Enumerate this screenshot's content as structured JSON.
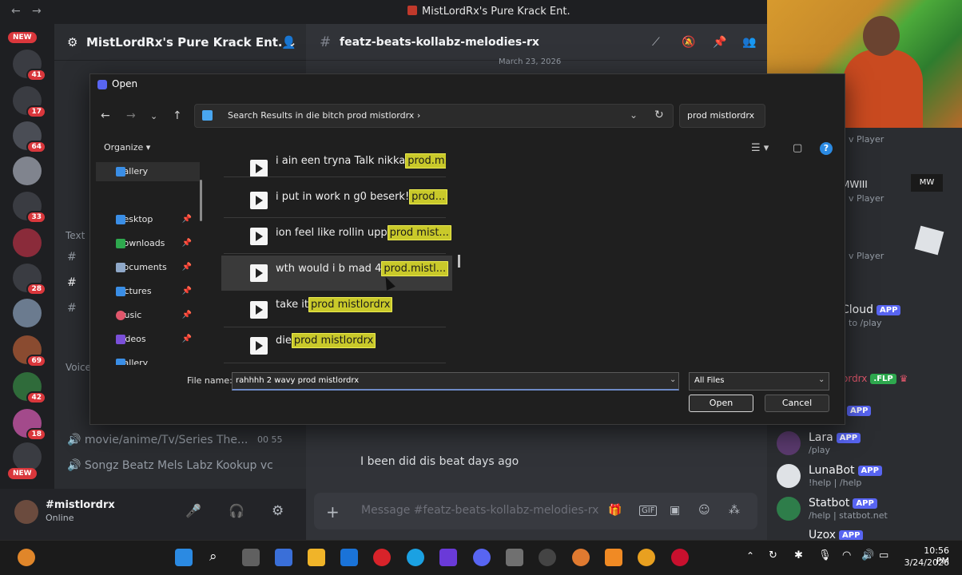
{
  "window": {
    "title": "MistLordRx's Pure Krack Ent."
  },
  "server_rail": {
    "new_label": "NEW",
    "badges": [
      "41",
      "17",
      "64",
      "33",
      "28",
      "69",
      "42",
      "18"
    ],
    "bottom_new_label": "NEW"
  },
  "guild": {
    "name": "MistLordRx's Pure Krack Ent."
  },
  "sidebar": {
    "text_label": "Text",
    "voice_label": "Voice",
    "voice_channel_1": "movie/anime/Tv/Series The...",
    "voice_channel_1_counts": "00  55",
    "voice_channel_2": "Songz Beatz Mels Labz Kookup vc"
  },
  "user_panel": {
    "name": "#mistlordrx",
    "status": "Online"
  },
  "chat": {
    "channel": "featz-beats-kollabz-melodies-rx",
    "date_divider": "March 23, 2026",
    "message": "I been did dis beat days ago",
    "composer_placeholder": "Message #featz-beats-kollabz-melodies-rx"
  },
  "members": {
    "entries": [
      {
        "name": "v Player",
        "sub": ""
      },
      {
        "name": "MWIII",
        "sub": "v Player"
      },
      {
        "name": "v Player",
        "sub": ""
      },
      {
        "name": "Cloud",
        "tag": "APP",
        "sub": "to /play"
      },
      {
        "name": "ordrx",
        "tag": ".FLP",
        "sub": ""
      },
      {
        "name": "",
        "tag": "APP",
        "sub": ""
      },
      {
        "name": "Lara",
        "tag": "APP",
        "sub": "/play"
      },
      {
        "name": "LunaBot",
        "tag": "APP",
        "sub": "!help | /help"
      },
      {
        "name": "Statbot",
        "tag": "APP",
        "sub": "/help | statbot.net"
      },
      {
        "name": "Uzox",
        "tag": "APP",
        "sub": ""
      }
    ]
  },
  "dialog": {
    "title": "Open",
    "address": "Search Results in die bitch prod mistlordrx",
    "search_value": "prod mistlordrx",
    "organize_label": "Organize",
    "nav_items": [
      {
        "label": "Gallery",
        "color": "#3a8ee6"
      },
      {
        "label": "Desktop",
        "color": "#3a8ee6"
      },
      {
        "label": "Downloads",
        "color": "#2ea84e"
      },
      {
        "label": "Documents",
        "color": "#8fa8c8"
      },
      {
        "label": "Pictures",
        "color": "#3a8ee6"
      },
      {
        "label": "Music",
        "color": "#e0566b"
      },
      {
        "label": "Videos",
        "color": "#7a4fd8"
      },
      {
        "label": "Gallery",
        "color": "#3a8ee6"
      }
    ],
    "files": [
      {
        "name": "i ain een tryna Talk nikka",
        "match": "prod.m..."
      },
      {
        "name": "i put in work n g0 beserk!",
        "match": "prod..."
      },
      {
        "name": "ion feel like rollin upp",
        "match": "prod mist..."
      },
      {
        "name": "wth would i b mad 4",
        "match": "prod.mistl..."
      },
      {
        "name": "take it",
        "match": "prod mistlordrx"
      },
      {
        "name": "die",
        "match": "prod mistlordrx"
      }
    ],
    "file_name_label": "File name:",
    "file_name_value": "rahhhh 2 wavy prod mistlordrx",
    "file_type": "All Files",
    "open_button": "Open",
    "cancel_button": "Cancel"
  },
  "taskbar": {
    "time": "10:56 PM",
    "date": "3/24/2026"
  }
}
